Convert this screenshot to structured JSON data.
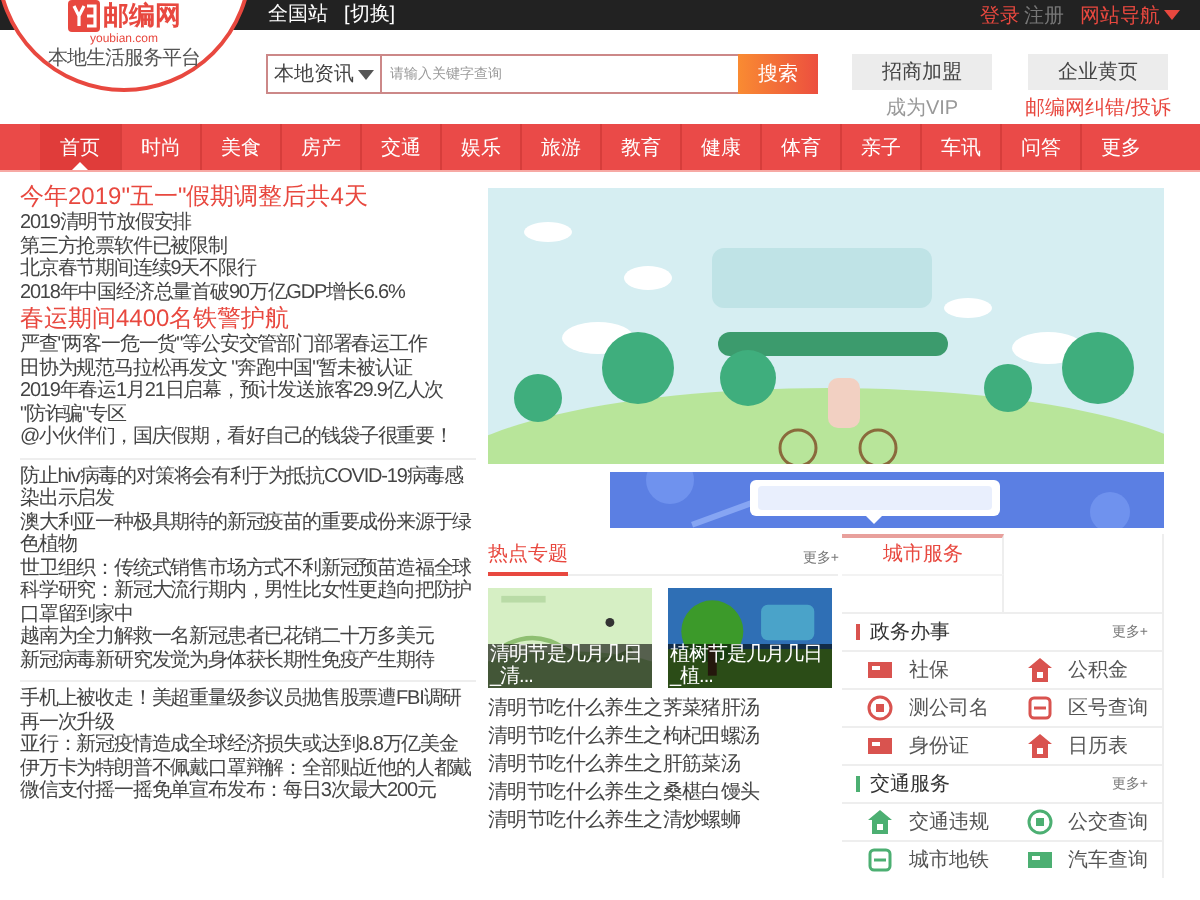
{
  "top_bar": {
    "links": [
      "全国站",
      "[切换]"
    ],
    "login": "登录",
    "register": "注册",
    "site_nav": "网站导航"
  },
  "logo": {
    "name": "邮编网",
    "domain": "youbian.com",
    "slogan": "本地生活服务平台"
  },
  "search": {
    "category": "本地资讯",
    "placeholder": "请输入关键字查询",
    "button": "搜索"
  },
  "header_buttons": [
    {
      "label": "招商加盟",
      "sublink": "成为VIP",
      "kind": "muted"
    },
    {
      "label": "企业黄页",
      "sublink": "邮编网纠错/投诉",
      "kind": "alert"
    }
  ],
  "nav": [
    {
      "label": "首页",
      "selected": true
    },
    {
      "label": "时尚",
      "selected": false
    },
    {
      "label": "美食",
      "selected": false
    },
    {
      "label": "房产",
      "selected": false
    },
    {
      "label": "交通",
      "selected": false
    },
    {
      "label": "娱乐",
      "selected": false
    },
    {
      "label": "旅游",
      "selected": false
    },
    {
      "label": "教育",
      "selected": false
    },
    {
      "label": "健康",
      "selected": false
    },
    {
      "label": "体育",
      "selected": false
    },
    {
      "label": "亲子",
      "selected": false
    },
    {
      "label": "车讯",
      "selected": false
    },
    {
      "label": "问答",
      "selected": false
    },
    {
      "label": "更多",
      "selected": false
    }
  ],
  "top_stories": [
    {
      "headline": "今年2019\"五一\"假期调整后共4天",
      "items": [
        {
          "text": "2019清明节放假安排"
        },
        {
          "text": "第三方抢票软件已被限制"
        },
        {
          "text": "北京春节期间连续9天不限行"
        },
        {
          "text": "2018年中国经济总量首破90万亿GDP增长6.6%"
        }
      ]
    },
    {
      "headline": "春运期间4400名铁警护航",
      "items": [
        {
          "text": "严查\"两客一危一货\"等公安交管部门部署春运工作"
        },
        {
          "text": "田协为规范马拉松再发文 \"奔跑中国\"暂未被认证"
        },
        {
          "text": "2019年春运1月21日启幕，预计发送旅客29.9亿人次"
        },
        {
          "text": "\"防诈骗\"专区",
          "extra": "@小伙伴们，国庆假期，看好自己的钱袋子很重要！"
        }
      ]
    }
  ],
  "news_lists": [
    [
      "防止hiv病毒的对策将会有利于为抵抗COVID-19病毒感染出示启发",
      "澳大利亚一种极具期待的新冠疫苗的重要成份来源于绿色植物",
      "世卫组织：传统式销售市场方式不利新冠预苗造福全球",
      "科学研究：新冠大流行期内，男性比女性更趋向把防护口罩留到家中",
      "越南为全力解救一名新冠患者已花销二十万多美元",
      "新冠病毒新研究发觉为身体获长期性免疫产生期待"
    ],
    [
      "手机上被收走！美超重量级参议员抛售股票遭FBI调研再一次升级",
      "亚行：新冠疫情造成全球经济损失或达到8.8万亿美金",
      "伊万卡为特朗普不佩戴口罩辩解：全部贴近他的人都戴",
      "微信支付摇一摇免单宣布发布：每日3次最大200元"
    ]
  ],
  "hot_topics": {
    "title": "热点专题",
    "more": "更多+",
    "thumbnails": [
      {
        "caption": "清明节是几月几日_清..."
      },
      {
        "caption": "植树节是几月几日_植..."
      }
    ],
    "items": [
      "清明节吃什么养生之荠菜猪肝汤",
      "清明节吃什么养生之枸杞田螺汤",
      "清明节吃什么养生之肝筋菜汤",
      "清明节吃什么养生之桑椹白馒头",
      "清明节吃什么养生之清炒螺蛳"
    ]
  },
  "city_services": {
    "tab": "城市服务",
    "sections": [
      {
        "title": "政务办事",
        "more": "更多+",
        "color": "#d9534f",
        "items": [
          "社保",
          "公积金",
          "测公司名",
          "区号查询",
          "身份证",
          "日历表"
        ]
      },
      {
        "title": "交通服务",
        "more": "更多+",
        "color": "#4caf72",
        "items": [
          "交通违规",
          "公交查询",
          "城市地铁",
          "汽车查询"
        ]
      }
    ]
  }
}
